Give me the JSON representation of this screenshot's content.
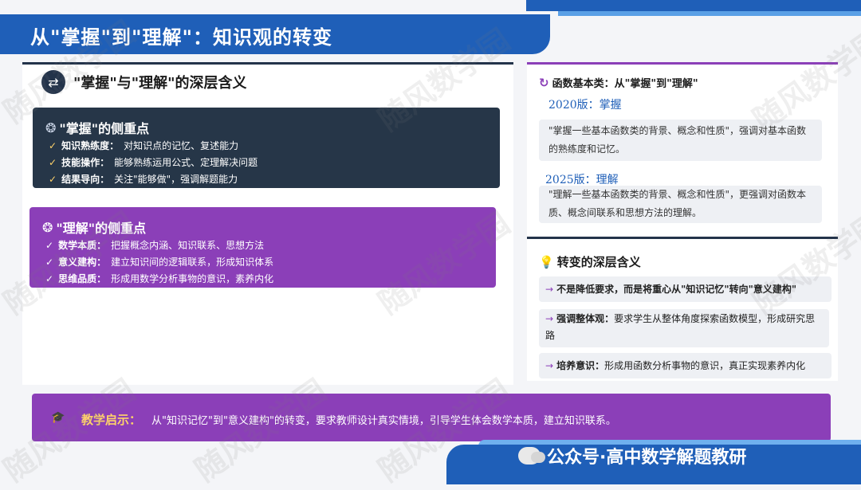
{
  "title": "从\"掌握\"到\"理解\"：知识观的转变",
  "left": {
    "heading": "\"掌握\"与\"理解\"的深层含义",
    "mastery": {
      "title": "\"掌握\"的侧重点",
      "items": [
        {
          "label": "知识熟练度：",
          "text": "对知识点的记忆、复述能力"
        },
        {
          "label": "技能操作：",
          "text": "能够熟练运用公式、定理解决问题"
        },
        {
          "label": "结果导向：",
          "text": "关注\"能够做\"，强调解题能力"
        }
      ]
    },
    "understanding": {
      "title": "\"理解\"的侧重点",
      "items": [
        {
          "label": "数学本质：",
          "text": "把握概念内涵、知识联系、思想方法"
        },
        {
          "label": "意义建构：",
          "text": "建立知识间的逻辑联系，形成知识体系"
        },
        {
          "label": "思维品质：",
          "text": "形成用数学分析事物的意识，素养内化"
        }
      ]
    }
  },
  "right": {
    "heading": "函数基本类：从\"掌握\"到\"理解\"",
    "v2020": {
      "label": "2020版：掌握",
      "text": "\"掌握一些基本函数类的背景、概念和性质\"，强调对基本函数的熟练度和记忆。"
    },
    "v2025": {
      "label": "2025版：理解",
      "text": "\"理解一些基本函数类的背景、概念和性质\"，更强调对函数本质、概念间联系和思想方法的理解。"
    },
    "heading2": "转变的深层含义",
    "points": [
      {
        "label": "",
        "text": "不是降低要求，而是将重心从\"知识记忆\"转向\"意义建构\""
      },
      {
        "label": "强调整体观：",
        "text": "要求学生从整体角度探索函数模型，形成研究思路"
      },
      {
        "label": "培养意识：",
        "text": "形成用函数分析事物的意识，真正实现素养内化"
      }
    ]
  },
  "insight": {
    "label": "教学启示：",
    "text": "从\"知识记忆\"到\"意义建构\"的转变，要求教师设计真实情境，引导学生体会数学本质，建立知识联系。"
  },
  "footer": {
    "wechat": "公众号·高中数学解题教研"
  },
  "watermark": "随风数学园",
  "colors": {
    "blue": "#1f5fb8",
    "dark": "#263648",
    "purple": "#8b3fb8",
    "gold": "#ffd36a"
  }
}
